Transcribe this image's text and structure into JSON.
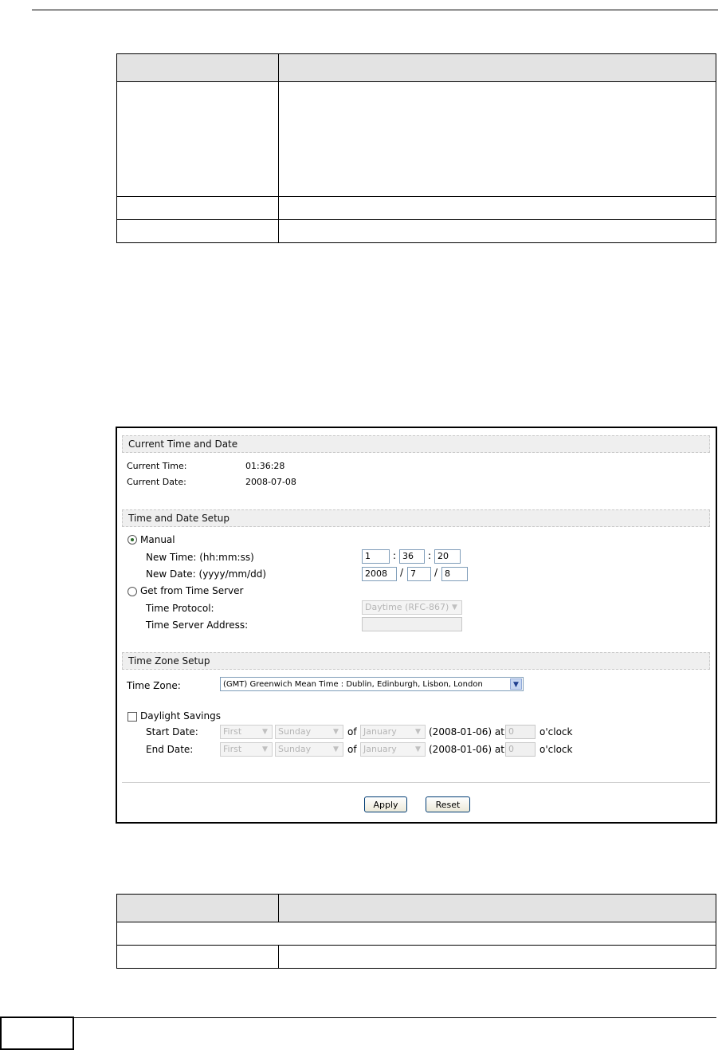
{
  "panel": {
    "current_section": "Current Time and Date",
    "current_time_label": "Current Time:",
    "current_time_value": "01:36:28",
    "current_date_label": "Current Date:",
    "current_date_value": "2008-07-08",
    "setup_section": "Time and Date Setup",
    "manual_label": "Manual",
    "new_time_label": "New Time: (hh:mm:ss)",
    "new_time_h": "1",
    "new_time_m": "36",
    "new_time_s": "20",
    "new_date_label": "New Date: (yyyy/mm/dd)",
    "new_date_y": "2008",
    "new_date_m": "7",
    "new_date_d": "8",
    "time_server_label": "Get from Time Server",
    "time_protocol_label": "Time Protocol:",
    "time_protocol_value": "Daytime (RFC-867)",
    "time_server_address_label": "Time Server Address:",
    "time_server_address_value": "",
    "zone_section": "Time Zone Setup",
    "time_zone_label": "Time Zone:",
    "time_zone_value": "(GMT) Greenwich Mean Time : Dublin, Edinburgh, Lisbon, London",
    "daylight_label": "Daylight Savings",
    "start_date_label": "Start Date:",
    "end_date_label": "End Date:",
    "week_value": "First",
    "day_value": "Sunday",
    "of_label": "of",
    "month_value": "January",
    "example_at": "(2008-01-06) at",
    "hour_value": "0",
    "oclock_label": "o'clock",
    "apply_label": "Apply",
    "reset_label": "Reset"
  },
  "colors": {
    "section_bar": "#efefef",
    "table_header": "#e3e3e3",
    "radio_dot": "#2b6a2b"
  }
}
